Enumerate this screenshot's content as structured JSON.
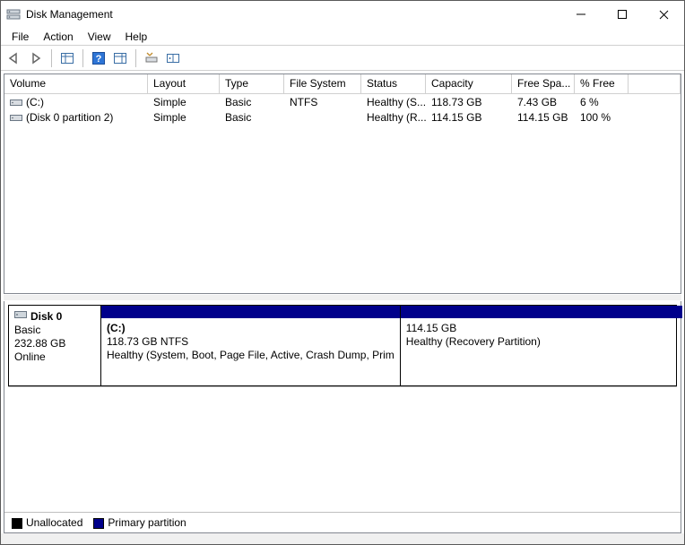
{
  "titlebar": {
    "title": "Disk Management"
  },
  "menu": {
    "file": "File",
    "action": "Action",
    "view": "View",
    "help": "Help"
  },
  "columns": {
    "volume": "Volume",
    "layout": "Layout",
    "type": "Type",
    "fs": "File System",
    "status": "Status",
    "capacity": "Capacity",
    "free": "Free Spa...",
    "pfree": "% Free"
  },
  "volumes": [
    {
      "name": "(C:)",
      "layout": "Simple",
      "type": "Basic",
      "fs": "NTFS",
      "status": "Healthy (S...",
      "capacity": "118.73 GB",
      "free": "7.43 GB",
      "pfree": "6 %"
    },
    {
      "name": "(Disk 0 partition 2)",
      "layout": "Simple",
      "type": "Basic",
      "fs": "",
      "status": "Healthy (R...",
      "capacity": "114.15 GB",
      "free": "114.15 GB",
      "pfree": "100 %"
    }
  ],
  "disk": {
    "name": "Disk 0",
    "type": "Basic",
    "size": "232.88 GB",
    "status": "Online",
    "partitions": [
      {
        "label": "(C:)",
        "line2": "118.73 GB NTFS",
        "line3": "Healthy (System, Boot, Page File, Active, Crash Dump, Prim",
        "widthPct": 51
      },
      {
        "label": "",
        "line2": "114.15 GB",
        "line3": "Healthy (Recovery Partition)",
        "widthPct": 49
      }
    ]
  },
  "legend": {
    "unalloc": "Unallocated",
    "primary": "Primary partition"
  }
}
